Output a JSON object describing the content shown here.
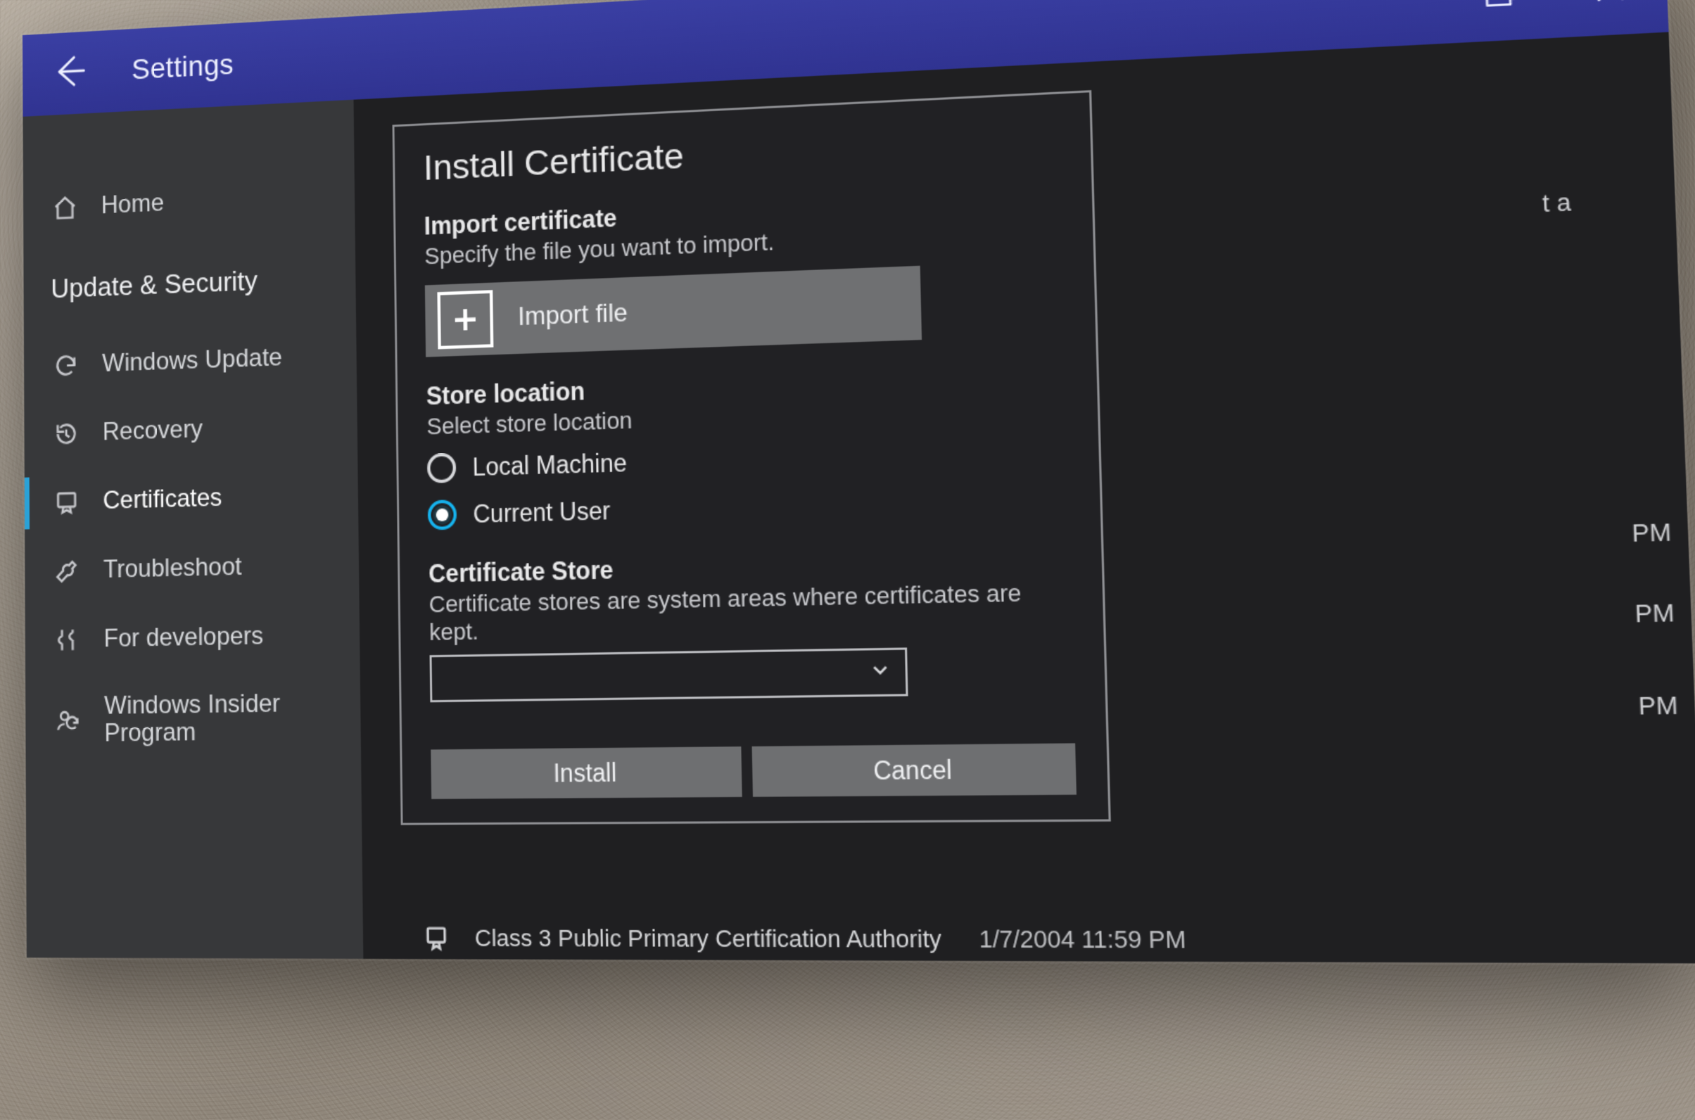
{
  "titlebar": {
    "title": "Settings",
    "back_icon": "back-arrow-icon",
    "restore_icon": "restore-window-icon",
    "close_icon": "close-icon"
  },
  "sidebar": {
    "home_label": "Home",
    "section_label": "Update & Security",
    "items": [
      {
        "id": "windows-update",
        "label": "Windows Update",
        "icon": "sync-icon",
        "selected": false
      },
      {
        "id": "recovery",
        "label": "Recovery",
        "icon": "history-icon",
        "selected": false
      },
      {
        "id": "certificates",
        "label": "Certificates",
        "icon": "certificate-icon",
        "selected": true
      },
      {
        "id": "troubleshoot",
        "label": "Troubleshoot",
        "icon": "wrench-icon",
        "selected": false
      },
      {
        "id": "for-developers",
        "label": "For developers",
        "icon": "tools-icon",
        "selected": false
      },
      {
        "id": "windows-insider",
        "label": "Windows Insider Program",
        "icon": "person-sync-icon",
        "selected": false
      }
    ]
  },
  "dialog": {
    "title": "Install Certificate",
    "import": {
      "heading": "Import certificate",
      "description": "Specify the file you want to import.",
      "button_label": "Import file"
    },
    "store_location": {
      "heading": "Store location",
      "description": "Select store location",
      "options": [
        {
          "id": "local-machine",
          "label": "Local Machine",
          "checked": false
        },
        {
          "id": "current-user",
          "label": "Current User",
          "checked": true
        }
      ]
    },
    "cert_store": {
      "heading": "Certificate Store",
      "description": "Certificate stores are system areas where certificates are kept.",
      "selected_value": ""
    },
    "actions": {
      "install_label": "Install",
      "cancel_label": "Cancel"
    }
  },
  "behind": {
    "text_fragment_ta": "t a",
    "pm_rows": [
      "PM",
      "PM",
      "PM"
    ],
    "bottom_row": {
      "name": "Class 3 Public Primary Certification Authority",
      "timestamp": "1/7/2004 11:59 PM"
    }
  }
}
